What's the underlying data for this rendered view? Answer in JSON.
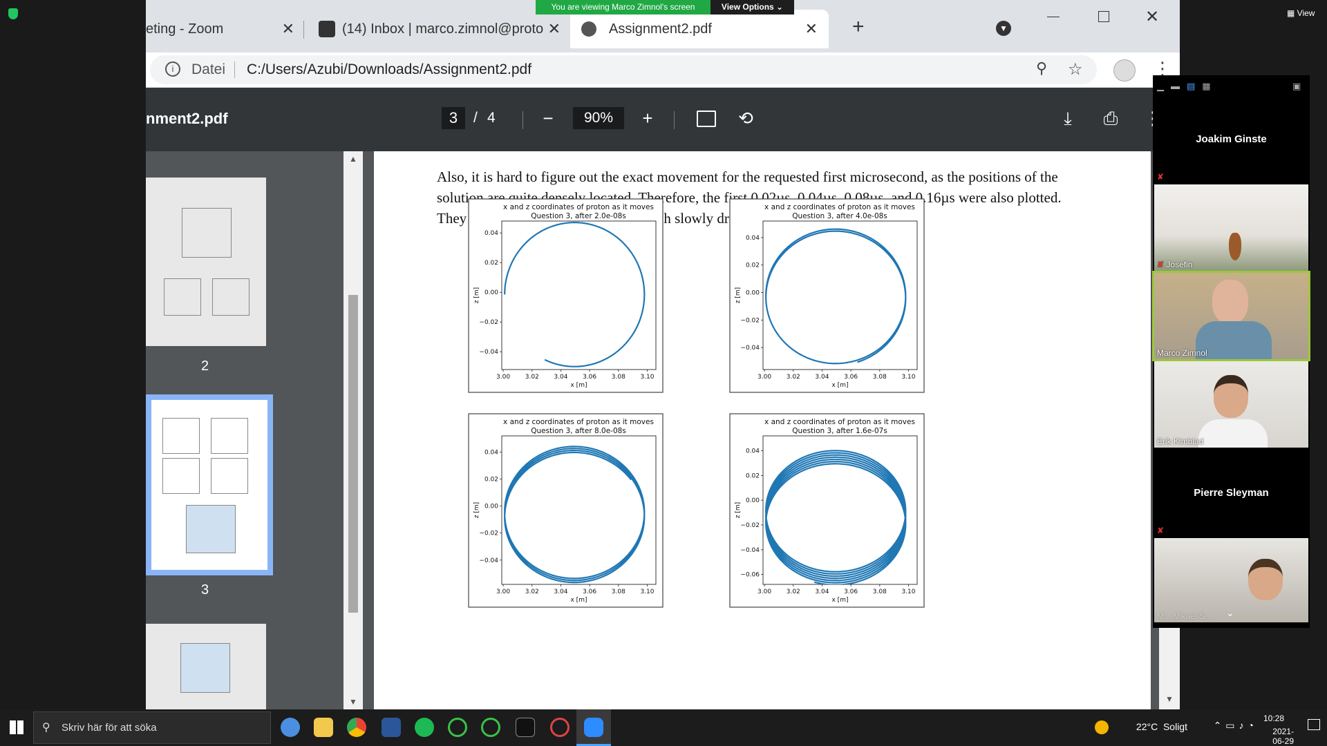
{
  "zoom_share": {
    "message": "You are viewing Marco Zimnol's screen",
    "view_options": "View Options ⌄"
  },
  "tabs": [
    {
      "label": "eting - Zoom"
    },
    {
      "label": "(14) Inbox | marco.zimnol@proto"
    },
    {
      "label": "Assignment2.pdf"
    }
  ],
  "address": {
    "scheme_label": "Datei",
    "url": "C:/Users/Azubi/Downloads/Assignment2.pdf"
  },
  "pdf": {
    "title": "nment2.pdf",
    "page_current": "3",
    "page_sep": "/",
    "page_total": "4",
    "zoom": "90%",
    "thumb_labels": [
      "2",
      "3"
    ],
    "paragraph": "Also, it is hard to figure out the exact movement for the requested first microsecond, as the positions of the solution are quite densely located. Therefore, the first 0.02µs, 0.04µs, 0.08µs, and 0.16µs were also plotted. They show a loop-like movement which slowly drifts downwards."
  },
  "chart_data": [
    {
      "type": "line",
      "title": "x and z coordinates of proton as it moves",
      "subtitle": "Question 3, after 2.0e-08s",
      "xlabel": "x [m]",
      "ylabel": "z [m]",
      "x_ticks": [
        "3.00",
        "3.02",
        "3.04",
        "3.06",
        "3.08",
        "3.10"
      ],
      "y_ticks": [
        "0.04",
        "0.02",
        "0.00",
        "−0.02",
        "−0.04"
      ],
      "xlim": [
        2.999,
        3.106
      ],
      "ylim": [
        -0.052,
        0.048
      ],
      "center": [
        3.0495,
        -0.0015
      ],
      "radius": 0.0485,
      "loops": 0.82,
      "drift": 0.0,
      "start_angle_deg": 180
    },
    {
      "type": "line",
      "title": "x and z coordinates of proton as it moves",
      "subtitle": "Question 3, after 4.0e-08s",
      "xlabel": "x [m]",
      "ylabel": "z [m]",
      "x_ticks": [
        "3.00",
        "3.02",
        "3.04",
        "3.06",
        "3.08",
        "3.10"
      ],
      "y_ticks": [
        "0.04",
        "0.02",
        "0.00",
        "−0.02",
        "−0.04"
      ],
      "xlim": [
        2.999,
        3.106
      ],
      "ylim": [
        -0.056,
        0.052
      ],
      "center": [
        3.0495,
        -0.002
      ],
      "radius": 0.0485,
      "loops": 1.7,
      "drift": -0.0025,
      "start_angle_deg": 180
    },
    {
      "type": "line",
      "title": "x and z coordinates of proton as it moves",
      "subtitle": "Question 3, after 8.0e-08s",
      "xlabel": "x [m]",
      "ylabel": "z [m]",
      "x_ticks": [
        "3.00",
        "3.02",
        "3.04",
        "3.06",
        "3.08",
        "3.10"
      ],
      "y_ticks": [
        "0.04",
        "0.02",
        "0.00",
        "−0.02",
        "−0.04"
      ],
      "xlim": [
        2.999,
        3.106
      ],
      "ylim": [
        -0.058,
        0.052
      ],
      "center": [
        3.0495,
        -0.004
      ],
      "radius": 0.0485,
      "loops": 3.4,
      "drift": -0.005,
      "start_angle_deg": 180
    },
    {
      "type": "line",
      "title": "x and z coordinates of proton as it moves",
      "subtitle": "Question 3, after 1.6e-07s",
      "xlabel": "x [m]",
      "ylabel": "z [m]",
      "x_ticks": [
        "3.00",
        "3.02",
        "3.04",
        "3.06",
        "3.08",
        "3.10"
      ],
      "y_ticks": [
        "0.04",
        "0.02",
        "0.00",
        "−0.02",
        "−0.04",
        "−0.06"
      ],
      "xlim": [
        2.999,
        3.106
      ],
      "ylim": [
        -0.068,
        0.052
      ],
      "center": [
        3.0495,
        -0.008
      ],
      "radius": 0.0485,
      "loops": 6.8,
      "drift": -0.012,
      "start_angle_deg": 180
    }
  ],
  "participants": {
    "top_name": "Joakim Ginste",
    "videos": [
      {
        "name": "Josefin"
      },
      {
        "name": "Marco Zimnol"
      },
      {
        "name": "Erik Kimblad"
      }
    ],
    "mid_name": "Pierre Sleyman",
    "last_video_name": "M... Mikael S..."
  },
  "zoom_view_label": "View",
  "taskbar": {
    "search_placeholder": "Skriv här för att söka",
    "weather": "22°C  Soligt",
    "time": "10:28",
    "date": "2021-06-29"
  },
  "colors": {
    "plot_line": "#1f77b4",
    "share_green": "#20a844",
    "active_speaker": "#9cc83c"
  }
}
